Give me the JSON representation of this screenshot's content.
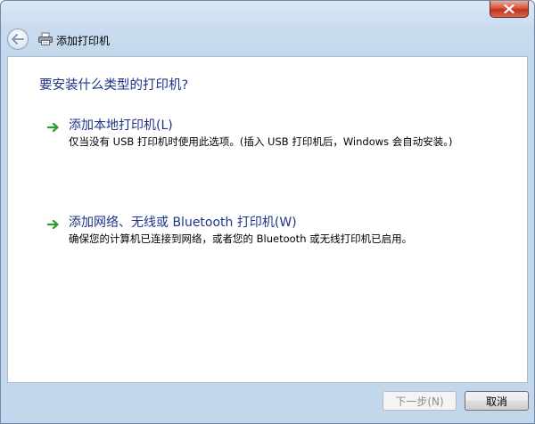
{
  "window": {
    "title": "添加打印机"
  },
  "content": {
    "heading": "要安装什么类型的打印机?",
    "options": [
      {
        "title": "添加本地打印机(L)",
        "description": "仅当没有 USB 打印机时使用此选项。(插入 USB 打印机后，Windows 会自动安装。)"
      },
      {
        "title": "添加网络、无线或 Bluetooth 打印机(W)",
        "description": "确保您的计算机已连接到网络，或者您的 Bluetooth 或无线打印机已启用。"
      }
    ]
  },
  "footer": {
    "next_label": "下一步(N)",
    "next_enabled": false,
    "cancel_label": "取消"
  },
  "icons": {
    "close": "close-icon",
    "back": "back-arrow-icon",
    "printer": "printer-icon",
    "option_arrow": "green-arrow-icon"
  },
  "colors": {
    "heading_text": "#1e3287",
    "option_arrow": "#2f9e2f",
    "close_button": "#c2321c"
  }
}
